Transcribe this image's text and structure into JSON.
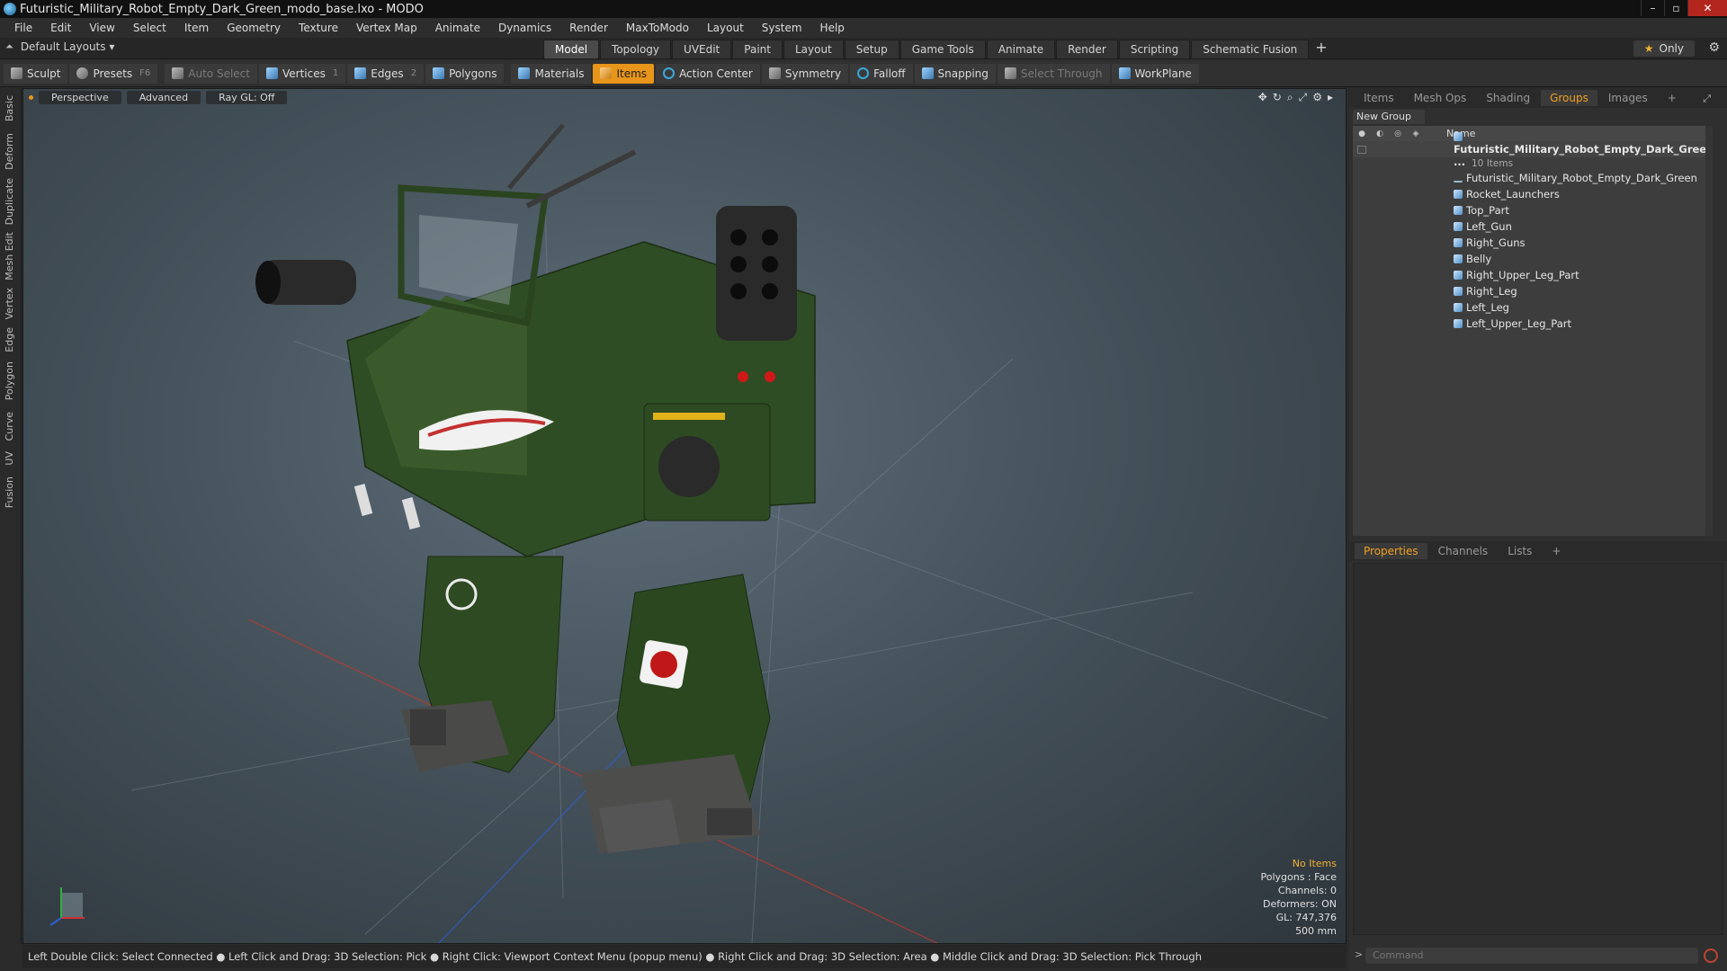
{
  "window": {
    "title": "Futuristic_Military_Robot_Empty_Dark_Green_modo_base.lxo - MODO",
    "buttons": [
      "–",
      "▫",
      "✕"
    ]
  },
  "menu": [
    "File",
    "Edit",
    "View",
    "Select",
    "Item",
    "Geometry",
    "Texture",
    "Vertex Map",
    "Animate",
    "Dynamics",
    "Render",
    "MaxToModo",
    "Layout",
    "System",
    "Help"
  ],
  "layoutbar": {
    "layouts_label": "Default Layouts ▾",
    "tabs": [
      "Model",
      "Topology",
      "UVEdit",
      "Paint",
      "Layout",
      "Setup",
      "Game Tools",
      "Animate",
      "Render",
      "Scripting",
      "Schematic Fusion"
    ],
    "active_tab": "Model",
    "plus": "+",
    "only_label": "Only"
  },
  "toolbar": {
    "sculpt": "Sculpt",
    "presets": "Presets",
    "presets_key": "F6",
    "auto_select": "Auto Select",
    "vertices": "Vertices",
    "vertices_key": "1",
    "edges": "Edges",
    "edges_key": "2",
    "polygons": "Polygons",
    "materials": "Materials",
    "items": "Items",
    "action_center": "Action Center",
    "symmetry": "Symmetry",
    "falloff": "Falloff",
    "snapping": "Snapping",
    "select_through": "Select Through",
    "workplane": "WorkPlane"
  },
  "left_tabs": [
    "Basic",
    "Deform",
    "Duplicate",
    "Mesh Edit",
    "Vertex",
    "Edge",
    "Polygon",
    "Curve",
    "UV",
    "Fusion"
  ],
  "viewport": {
    "view_mode": "Perspective",
    "shading": "Advanced",
    "raygl": "Ray GL: Off",
    "info": {
      "selection": "No Items",
      "polygons": "Polygons : Face",
      "channels": "Channels: 0",
      "deformers": "Deformers: ON",
      "gl": "GL: 747,376",
      "scale": "500 mm"
    }
  },
  "statusbar": "Left Double Click: Select Connected ● Left Click and Drag: 3D Selection: Pick ● Right Click: Viewport Context Menu (popup menu) ● Right Click and Drag: 3D Selection: Area ● Middle Click and Drag: 3D Selection: Pick Through",
  "right_panel": {
    "top_tabs": [
      "Items",
      "Mesh Ops",
      "Shading",
      "Groups",
      "Images"
    ],
    "active_top_tab": "Groups",
    "new_group": "New Group",
    "column_name": "Name",
    "root_item": "Futuristic_Military_Robot_Empty_Dark_Gree ...",
    "root_count": "10 Items",
    "items": [
      "Futuristic_Military_Robot_Empty_Dark_Green",
      "Rocket_Launchers",
      "Top_Part",
      "Left_Gun",
      "Right_Guns",
      "Belly",
      "Right_Upper_Leg_Part",
      "Right_Leg",
      "Left_Leg",
      "Left_Upper_Leg_Part"
    ],
    "bottom_tabs": [
      "Properties",
      "Channels",
      "Lists"
    ],
    "active_bottom_tab": "Properties",
    "command_placeholder": "Command"
  },
  "colors": {
    "accent": "#e8951b",
    "robot_green": "#2d4a22",
    "viewport_bg": "#4a5760"
  }
}
